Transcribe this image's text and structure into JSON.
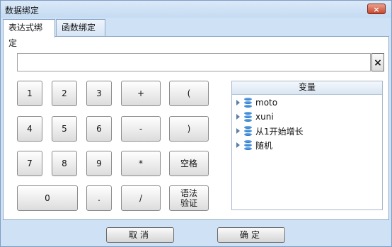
{
  "window": {
    "title": "数据绑定",
    "close_symbol": "×"
  },
  "tabs": [
    {
      "label": "表达式绑定",
      "active": true
    },
    {
      "label": "函数绑定",
      "active": false
    }
  ],
  "expression": {
    "value": "",
    "clear_symbol": "×"
  },
  "keypad": {
    "k1": "1",
    "k2": "2",
    "k3": "3",
    "plus": "+",
    "lparen": "(",
    "k4": "4",
    "k5": "5",
    "k6": "6",
    "minus": "-",
    "rparen": ")",
    "k7": "7",
    "k8": "8",
    "k9": "9",
    "multiply": "*",
    "space": "空格",
    "k0": "0",
    "dot": ".",
    "divide": "/",
    "syntax_check_line1": "语法",
    "syntax_check_line2": "验证"
  },
  "variables": {
    "header": "变量",
    "items": [
      {
        "label": "moto",
        "icon": "database-icon"
      },
      {
        "label": "xuni",
        "icon": "database-icon"
      },
      {
        "label": "从1开始增长",
        "icon": "database-icon"
      },
      {
        "label": "随机",
        "icon": "database-icon"
      }
    ]
  },
  "footer": {
    "cancel_label": "取消",
    "ok_label": "确定"
  },
  "colors": {
    "window_bg": "#cfe2f5",
    "close_button": "#c8452d",
    "db_icon": "#2a76c9"
  }
}
